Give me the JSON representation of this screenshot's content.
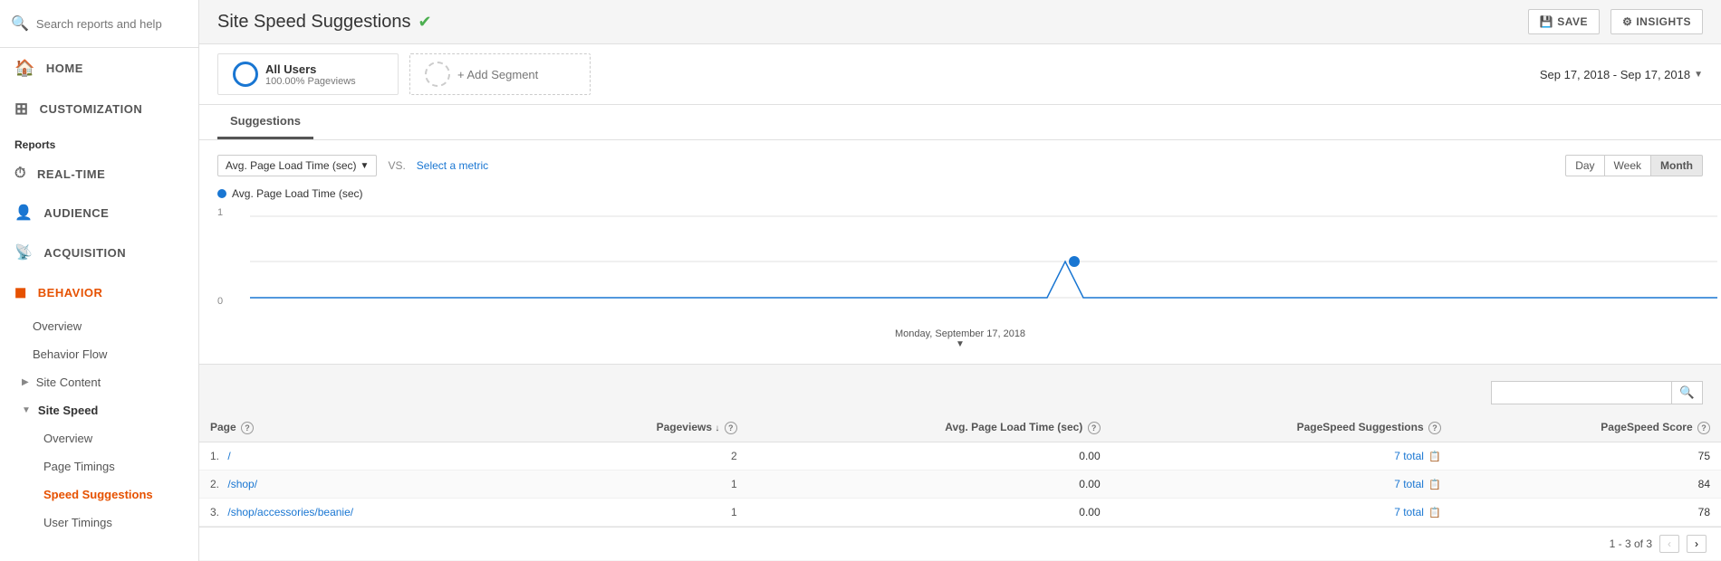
{
  "sidebar": {
    "search_placeholder": "Search reports and help",
    "nav_items": [
      {
        "id": "home",
        "label": "HOME",
        "icon": "🏠"
      },
      {
        "id": "customization",
        "label": "CUSTOMIZATION",
        "icon": "⊞"
      }
    ],
    "reports_label": "Reports",
    "report_items": [
      {
        "id": "realtime",
        "label": "REAL-TIME",
        "icon": "⏱",
        "type": "top"
      },
      {
        "id": "audience",
        "label": "AUDIENCE",
        "icon": "👤",
        "type": "top"
      },
      {
        "id": "acquisition",
        "label": "ACQUISITION",
        "icon": "📡",
        "type": "top"
      },
      {
        "id": "behavior",
        "label": "BEHAVIOR",
        "icon": "◼",
        "type": "top",
        "highlight": true
      }
    ],
    "behavior_children": [
      {
        "id": "overview",
        "label": "Overview",
        "active": false
      },
      {
        "id": "behavior-flow",
        "label": "Behavior Flow",
        "active": false
      }
    ],
    "site_content_label": "Site Content",
    "site_speed_label": "Site Speed",
    "site_speed_children": [
      {
        "id": "ss-overview",
        "label": "Overview",
        "active": false
      },
      {
        "id": "page-timings",
        "label": "Page Timings",
        "active": false
      },
      {
        "id": "speed-suggestions",
        "label": "Speed Suggestions",
        "active": true
      }
    ],
    "user_timings_label": "User Timings"
  },
  "header": {
    "title": "Site Speed Suggestions",
    "check_icon": "✔",
    "save_label": "SAVE",
    "insights_label": "INSIGHTS"
  },
  "segment": {
    "name": "All Users",
    "percentage": "100.00% Pageviews",
    "add_label": "+ Add Segment"
  },
  "date_range": {
    "label": "Sep 17, 2018 - Sep 17, 2018"
  },
  "tabs": [
    {
      "id": "suggestions",
      "label": "Suggestions",
      "active": true
    }
  ],
  "chart": {
    "metric_label": "Avg. Page Load Time (sec)",
    "vs_label": "VS.",
    "select_metric_label": "Select a metric",
    "time_buttons": [
      {
        "id": "day",
        "label": "Day",
        "active": false
      },
      {
        "id": "week",
        "label": "Week",
        "active": false
      },
      {
        "id": "month",
        "label": "Month",
        "active": true
      }
    ],
    "legend_label": "Avg. Page Load Time (sec)",
    "y_top": "1",
    "y_bottom": "0",
    "date_label": "Monday, September 17, 2018"
  },
  "table": {
    "search_placeholder": "",
    "columns": [
      {
        "id": "page",
        "label": "Page"
      },
      {
        "id": "pageviews",
        "label": "Pageviews"
      },
      {
        "id": "avg_load",
        "label": "Avg. Page Load Time (sec)"
      },
      {
        "id": "ps_suggestions",
        "label": "PageSpeed Suggestions"
      },
      {
        "id": "ps_score",
        "label": "PageSpeed Score"
      }
    ],
    "rows": [
      {
        "num": "1.",
        "page": "/",
        "pageviews": "2",
        "avg_load": "0.00",
        "ps_suggestions": "7 total",
        "ps_score": "75"
      },
      {
        "num": "2.",
        "page": "/shop/",
        "pageviews": "1",
        "avg_load": "0.00",
        "ps_suggestions": "7 total",
        "ps_score": "84"
      },
      {
        "num": "3.",
        "page": "/shop/accessories/beanie/",
        "pageviews": "1",
        "avg_load": "0.00",
        "ps_suggestions": "7 total",
        "ps_score": "78"
      }
    ],
    "pagination": "1 - 3 of 3"
  },
  "colors": {
    "accent_blue": "#1976d2",
    "accent_orange": "#e65100",
    "green_check": "#4caf50"
  }
}
